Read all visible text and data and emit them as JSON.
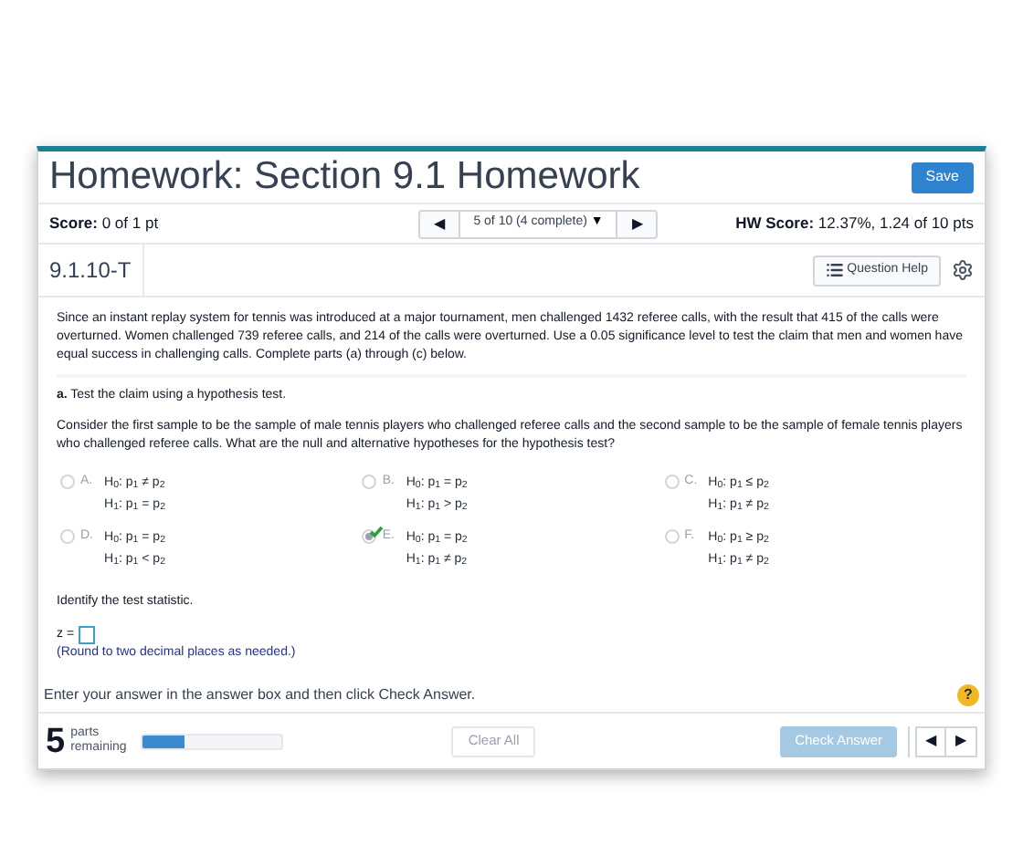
{
  "header": {
    "title": "Homework: Section 9.1 Homework",
    "save_button": "Save"
  },
  "score_bar": {
    "score_label": "Score:",
    "score_value": "0 of 1 pt",
    "nav_prev": "◀",
    "nav_position": "5 of 10 (4 complete)",
    "nav_caret": "▼",
    "nav_next": "▶",
    "hw_label": "HW Score:",
    "hw_value": "12.37%, 1.24 of 10 pts"
  },
  "question_bar": {
    "id": "9.1.10-T",
    "help_button": "Question Help"
  },
  "problem": "Since an instant replay system for tennis was introduced at a major tournament, men challenged 1432 referee calls, with the result that 415 of the calls were overturned. Women challenged 739 referee calls, and 214 of the calls were overturned. Use a 0.05 significance level to test the claim that men and women have equal success in challenging calls. Complete parts (a) through (c) below.",
  "part": {
    "text": "**a.** Test the claim using a hypothesis test.",
    "prompt": "Consider the first sample to be the sample of male tennis players who challenged referee calls and the second sample to be the sample of female tennis players who challenged referee calls. What are the null and alternative hypotheses for the hypothesis test?"
  },
  "options": [
    {
      "letter": "A.",
      "h0": "H$_{0}$: p$_{1}$ ≠ p$_{2}$",
      "h1": "H$_{1}$: p$_{1}$ = p$_{2}$",
      "selected": false
    },
    {
      "letter": "B.",
      "h0": "H$_{0}$: p$_{1}$ = p$_{2}$",
      "h1": "H$_{1}$: p$_{1}$ > p$_{2}$",
      "selected": false
    },
    {
      "letter": "C.",
      "h0": "H$_{0}$: p$_{1}$ ≤ p$_{2}$",
      "h1": "H$_{1}$: p$_{1}$ ≠ p$_{2}$",
      "selected": false
    },
    {
      "letter": "D.",
      "h0": "H$_{0}$: p$_{1}$ = p$_{2}$",
      "h1": "H$_{1}$: p$_{1}$ < p$_{2}$",
      "selected": false
    },
    {
      "letter": "E.",
      "h0": "H$_{0}$: p$_{1}$ = p$_{2}$",
      "h1": "H$_{1}$: p$_{1}$ ≠ p$_{2}$",
      "selected": true
    },
    {
      "letter": "F.",
      "h0": "H$_{0}$: p$_{1}$ ≥ p$_{2}$",
      "h1": "H$_{1}$: p$_{1}$ ≠ p$_{2}$",
      "selected": false
    }
  ],
  "statistic": {
    "prompt": "Identify the test statistic.",
    "label": "z =",
    "hint": "(Round to two decimal places as needed.)"
  },
  "instruction": "Enter your answer in the answer box and then click Check Answer.",
  "help_icon": "?",
  "footer": {
    "parts_count": "5",
    "parts_label": "parts",
    "parts_label_2": "remaining",
    "level": 0.3,
    "clear_button": "Clear All",
    "check_button": "Check Answer",
    "prev": "◀",
    "next": "▶"
  }
}
